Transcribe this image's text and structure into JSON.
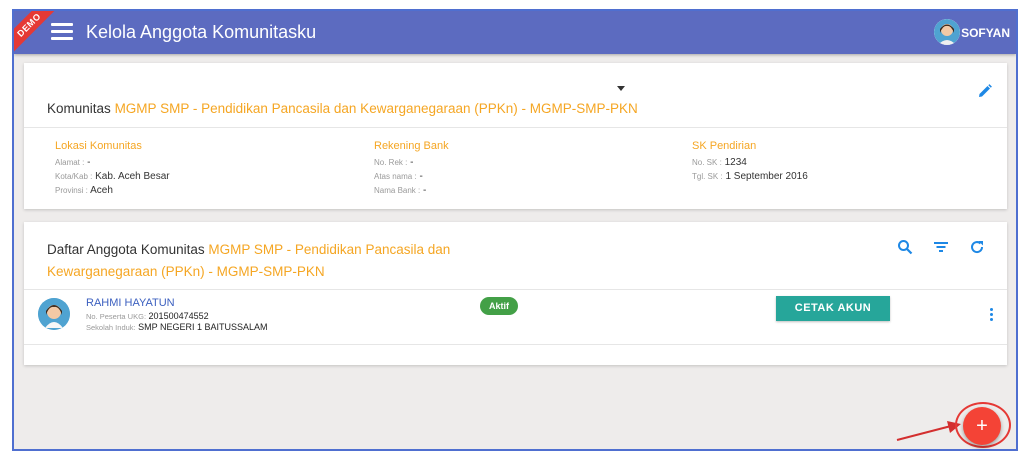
{
  "appbar": {
    "demo_label": "DEMO",
    "title": "Kelola Anggota Komunitasku",
    "user_name": "SOFYAN"
  },
  "community": {
    "prefix": "Komunitas",
    "name": "MGMP SMP - Pendidikan Pancasila dan Kewarganegaraan (PPKn) - MGMP-SMP-PKN",
    "location": {
      "heading": "Lokasi Komunitas",
      "alamat_label": "Alamat :",
      "alamat": "-",
      "kota_label": "Kota/Kab :",
      "kota": "Kab. Aceh Besar",
      "provinsi_label": "Provinsi :",
      "provinsi": "Aceh"
    },
    "bank": {
      "heading": "Rekening Bank",
      "norek_label": "No. Rek :",
      "norek": "-",
      "atas_nama_label": "Atas nama :",
      "atas_nama": "-",
      "nama_bank_label": "Nama Bank :",
      "nama_bank": "-"
    },
    "sk": {
      "heading": "SK Pendirian",
      "no_sk_label": "No. SK :",
      "no_sk": "1234",
      "tgl_sk_label": "Tgl. SK :",
      "tgl_sk": "1 September 2016"
    }
  },
  "member_list": {
    "prefix": "Daftar Anggota Komunitas",
    "name_line1": "MGMP SMP - Pendidikan Pancasila dan",
    "name_line2": "Kewarganegaraan (PPKn) - MGMP-SMP-PKN",
    "members": [
      {
        "name": "RAHMI HAYATUN",
        "ukg_label": "No. Peserta UKG:",
        "ukg": "201500474552",
        "school_label": "Sekolah Induk:",
        "school": "SMP NEGERI 1 BAITUSSALAM",
        "status": "Aktif",
        "action_label": "CETAK AKUN"
      }
    ]
  },
  "fab": {
    "label": "+"
  },
  "colors": {
    "appbar": "#5c6bc0",
    "accent_orange": "#f5a623",
    "active_badge": "#43a047",
    "button_teal": "#26a69a",
    "fab_red": "#f44336",
    "icon_blue": "#1e88e5"
  },
  "icons": [
    "menu-icon",
    "avatar",
    "chevron-down-icon",
    "edit-icon",
    "search-icon",
    "filter-icon",
    "refresh-icon",
    "more-vert-icon",
    "add-icon"
  ]
}
